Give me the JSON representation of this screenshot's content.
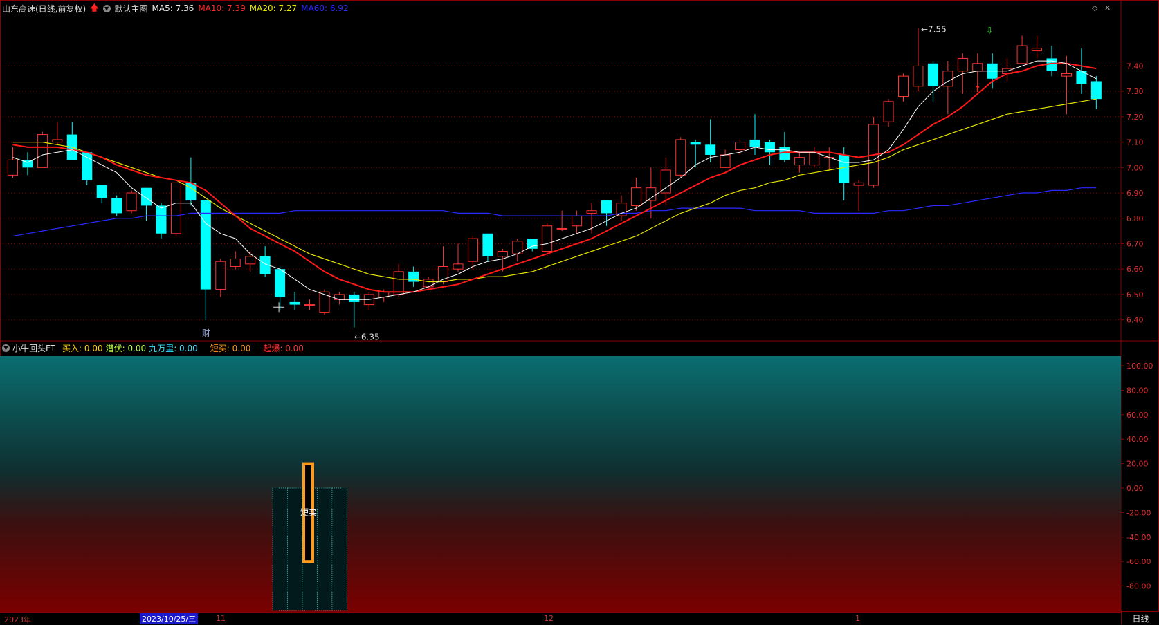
{
  "main_header": {
    "title": "山东高速(日线,前复权)",
    "indicator_name": "默认主图",
    "ma5": "MA5: 7.36",
    "ma10": "MA10: 7.39",
    "ma20": "MA20: 7.27",
    "ma60": "MA60: 6.92"
  },
  "price_axis": [
    "7.40",
    "7.30",
    "7.20",
    "7.10",
    "7.00",
    "6.90",
    "6.80",
    "6.70",
    "6.60",
    "6.50",
    "6.40"
  ],
  "annotations": {
    "high_label": "7.55",
    "low_label": "6.35",
    "event_marker": "财"
  },
  "indicator_header": {
    "name": "小牛回头FT",
    "buy": "买入: 0.00",
    "latent": "潜伏: 0.00",
    "jiuwanli": "九万里: 0.00",
    "short_buy": "短买: 0.00",
    "takeoff": "起爆: 0.00"
  },
  "indicator_axis": [
    "100.00",
    "80.00",
    "60.00",
    "40.00",
    "20.00",
    "0.00",
    "-20.00",
    "-40.00",
    "-60.00",
    "-80.00"
  ],
  "indicator_bar_label": "短买",
  "time_axis": {
    "year": "2023年",
    "selected_date": "2023/10/25/三",
    "m11": "11",
    "m12": "12",
    "m1": "1"
  },
  "period_label": "日线",
  "colors": {
    "up": "#ff3333",
    "down": "#00ffff",
    "ma5": "#ffffff",
    "ma10": "#ff1a1a",
    "ma20": "#e6e600",
    "ma60": "#2a2aff",
    "grid": "#8b0000"
  },
  "chart_data": {
    "type": "candlestick",
    "ylim": [
      6.32,
      7.6
    ],
    "candles": [
      [
        6.97,
        7.03,
        7.08,
        6.96
      ],
      [
        7.03,
        7.0,
        7.06,
        6.97
      ],
      [
        7.0,
        7.13,
        7.14,
        7.0
      ],
      [
        7.1,
        7.11,
        7.18,
        7.09
      ],
      [
        7.13,
        7.03,
        7.18,
        7.03
      ],
      [
        7.06,
        6.95,
        7.06,
        6.93
      ],
      [
        6.93,
        6.88,
        6.93,
        6.86
      ],
      [
        6.88,
        6.82,
        6.89,
        6.81
      ],
      [
        6.83,
        6.9,
        6.91,
        6.82
      ],
      [
        6.92,
        6.85,
        6.92,
        6.79
      ],
      [
        6.85,
        6.74,
        6.86,
        6.72
      ],
      [
        6.74,
        6.94,
        6.94,
        6.73
      ],
      [
        6.94,
        6.87,
        7.04,
        6.85
      ],
      [
        6.87,
        6.52,
        6.87,
        6.4
      ],
      [
        6.52,
        6.63,
        6.64,
        6.49
      ],
      [
        6.61,
        6.64,
        6.67,
        6.6
      ],
      [
        6.62,
        6.65,
        6.67,
        6.59
      ],
      [
        6.65,
        6.58,
        6.69,
        6.57
      ],
      [
        6.6,
        6.49,
        6.61,
        6.44
      ],
      [
        6.47,
        6.46,
        6.51,
        6.44
      ],
      [
        6.46,
        6.46,
        6.48,
        6.44
      ],
      [
        6.43,
        6.51,
        6.52,
        6.42
      ],
      [
        6.48,
        6.5,
        6.51,
        6.46
      ],
      [
        6.5,
        6.47,
        6.51,
        6.37
      ],
      [
        6.46,
        6.5,
        6.51,
        6.44
      ],
      [
        6.49,
        6.51,
        6.52,
        6.47
      ],
      [
        6.5,
        6.59,
        6.62,
        6.49
      ],
      [
        6.59,
        6.55,
        6.61,
        6.53
      ],
      [
        6.53,
        6.56,
        6.57,
        6.52
      ],
      [
        6.55,
        6.61,
        6.69,
        6.54
      ],
      [
        6.6,
        6.62,
        6.7,
        6.59
      ],
      [
        6.63,
        6.72,
        6.73,
        6.6
      ],
      [
        6.74,
        6.65,
        6.74,
        6.63
      ],
      [
        6.65,
        6.67,
        6.68,
        6.59
      ],
      [
        6.66,
        6.71,
        6.72,
        6.63
      ],
      [
        6.72,
        6.68,
        6.72,
        6.67
      ],
      [
        6.67,
        6.77,
        6.78,
        6.65
      ],
      [
        6.76,
        6.76,
        6.83,
        6.75
      ],
      [
        6.77,
        6.81,
        6.83,
        6.74
      ],
      [
        6.82,
        6.83,
        6.86,
        6.74
      ],
      [
        6.87,
        6.82,
        6.87,
        6.77
      ],
      [
        6.81,
        6.86,
        6.89,
        6.79
      ],
      [
        6.85,
        6.92,
        6.96,
        6.83
      ],
      [
        6.87,
        6.92,
        7.0,
        6.8
      ],
      [
        6.9,
        6.99,
        7.04,
        6.85
      ],
      [
        6.97,
        7.11,
        7.12,
        6.96
      ],
      [
        7.1,
        7.09,
        7.11,
        7.0
      ],
      [
        7.09,
        7.05,
        7.19,
        7.02
      ],
      [
        7.0,
        7.05,
        7.07,
        7.0
      ],
      [
        7.07,
        7.1,
        7.11,
        7.05
      ],
      [
        7.11,
        7.08,
        7.21,
        7.05
      ],
      [
        7.1,
        7.06,
        7.11,
        7.01
      ],
      [
        7.08,
        7.03,
        7.14,
        7.02
      ],
      [
        7.01,
        7.04,
        7.06,
        6.98
      ],
      [
        7.01,
        7.06,
        7.08,
        7.0
      ],
      [
        7.04,
        7.04,
        7.08,
        6.99
      ],
      [
        7.05,
        6.94,
        7.08,
        6.87
      ],
      [
        6.93,
        6.94,
        6.95,
        6.83
      ],
      [
        6.93,
        7.17,
        7.2,
        6.92
      ],
      [
        7.18,
        7.26,
        7.27,
        7.16
      ],
      [
        7.28,
        7.36,
        7.37,
        7.26
      ],
      [
        7.32,
        7.4,
        7.55,
        7.3
      ],
      [
        7.41,
        7.32,
        7.42,
        7.26
      ],
      [
        7.32,
        7.38,
        7.42,
        7.21
      ],
      [
        7.38,
        7.43,
        7.45,
        7.29
      ],
      [
        7.38,
        7.41,
        7.45,
        7.31
      ],
      [
        7.41,
        7.35,
        7.45,
        7.31
      ],
      [
        7.37,
        7.39,
        7.43,
        7.34
      ],
      [
        7.41,
        7.48,
        7.52,
        7.41
      ],
      [
        7.46,
        7.47,
        7.52,
        7.43
      ],
      [
        7.43,
        7.38,
        7.48,
        7.36
      ],
      [
        7.36,
        7.37,
        7.44,
        7.21
      ],
      [
        7.38,
        7.33,
        7.47,
        7.29
      ],
      [
        7.34,
        7.27,
        7.36,
        7.23
      ]
    ],
    "ma5": [
      7.04,
      7.02,
      7.05,
      7.06,
      7.07,
      7.04,
      7.01,
      6.98,
      6.92,
      6.88,
      6.84,
      6.86,
      6.86,
      6.78,
      6.74,
      6.72,
      6.66,
      6.62,
      6.6,
      6.56,
      6.52,
      6.5,
      6.48,
      6.48,
      6.48,
      6.49,
      6.5,
      6.51,
      6.53,
      6.56,
      6.58,
      6.61,
      6.63,
      6.64,
      6.66,
      6.69,
      6.7,
      6.72,
      6.74,
      6.76,
      6.79,
      6.82,
      6.84,
      6.88,
      6.92,
      6.96,
      7.01,
      7.04,
      7.05,
      7.06,
      7.08,
      7.07,
      7.07,
      7.06,
      7.06,
      7.04,
      7.02,
      7.02,
      7.03,
      7.07,
      7.15,
      7.24,
      7.3,
      7.34,
      7.37,
      7.38,
      7.38,
      7.38,
      7.4,
      7.42,
      7.42,
      7.41,
      7.38,
      7.35
    ],
    "ma10": [
      7.09,
      7.08,
      7.08,
      7.08,
      7.07,
      7.06,
      7.04,
      7.01,
      6.99,
      6.97,
      6.96,
      6.95,
      6.94,
      6.91,
      6.86,
      6.81,
      6.76,
      6.73,
      6.7,
      6.67,
      6.63,
      6.59,
      6.56,
      6.54,
      6.52,
      6.51,
      6.51,
      6.51,
      6.52,
      6.53,
      6.54,
      6.56,
      6.58,
      6.6,
      6.62,
      6.64,
      6.66,
      6.68,
      6.7,
      6.72,
      6.75,
      6.78,
      6.81,
      6.84,
      6.87,
      6.9,
      6.93,
      6.96,
      6.98,
      7.01,
      7.03,
      7.05,
      7.06,
      7.06,
      7.06,
      7.06,
      7.05,
      7.04,
      7.05,
      7.06,
      7.09,
      7.13,
      7.17,
      7.2,
      7.24,
      7.29,
      7.34,
      7.37,
      7.38,
      7.4,
      7.41,
      7.41,
      7.4,
      7.39
    ],
    "ma20": [
      7.1,
      7.1,
      7.1,
      7.09,
      7.08,
      7.06,
      7.04,
      7.02,
      7.0,
      6.98,
      6.96,
      6.95,
      6.92,
      6.88,
      6.84,
      6.81,
      6.78,
      6.75,
      6.72,
      6.69,
      6.66,
      6.64,
      6.62,
      6.6,
      6.58,
      6.57,
      6.56,
      6.56,
      6.55,
      6.55,
      6.56,
      6.56,
      6.57,
      6.57,
      6.58,
      6.59,
      6.61,
      6.63,
      6.65,
      6.67,
      6.69,
      6.71,
      6.73,
      6.76,
      6.79,
      6.82,
      6.84,
      6.86,
      6.89,
      6.91,
      6.92,
      6.94,
      6.95,
      6.97,
      6.98,
      6.99,
      7.0,
      7.01,
      7.02,
      7.04,
      7.07,
      7.09,
      7.11,
      7.13,
      7.15,
      7.17,
      7.19,
      7.21,
      7.22,
      7.23,
      7.24,
      7.25,
      7.26,
      7.27
    ],
    "ma60": [
      6.73,
      6.74,
      6.75,
      6.76,
      6.77,
      6.78,
      6.79,
      6.8,
      6.8,
      6.81,
      6.81,
      6.81,
      6.82,
      6.82,
      6.82,
      6.82,
      6.82,
      6.82,
      6.82,
      6.83,
      6.83,
      6.83,
      6.83,
      6.83,
      6.83,
      6.83,
      6.83,
      6.83,
      6.83,
      6.83,
      6.82,
      6.82,
      6.82,
      6.81,
      6.81,
      6.81,
      6.81,
      6.81,
      6.81,
      6.81,
      6.81,
      6.82,
      6.82,
      6.83,
      6.83,
      6.84,
      6.84,
      6.84,
      6.84,
      6.84,
      6.83,
      6.83,
      6.83,
      6.83,
      6.82,
      6.82,
      6.82,
      6.82,
      6.82,
      6.83,
      6.83,
      6.84,
      6.85,
      6.85,
      6.86,
      6.87,
      6.88,
      6.89,
      6.9,
      6.9,
      6.91,
      6.91,
      6.92,
      6.92
    ],
    "indicator": {
      "ylim": [
        -100,
        100
      ],
      "short_buy_bar": {
        "index": 20,
        "top": 20,
        "bottom": -60
      },
      "box_indices": [
        18,
        22
      ]
    }
  }
}
